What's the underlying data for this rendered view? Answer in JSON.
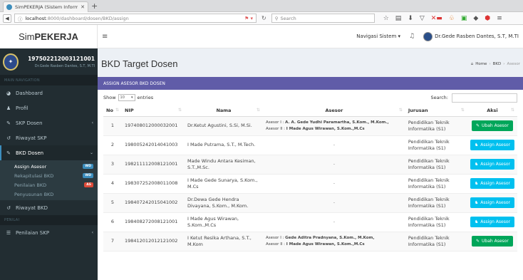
{
  "browser": {
    "tab_title": "SimPEKERJA (Sistem Inform...",
    "url_host": "localhost",
    "url_path": ":8000/dashboard/dosen/BKD/assign",
    "search_placeholder": "Search"
  },
  "header": {
    "logo_prefix": "Sim",
    "logo_bold": "PEKERJA",
    "nav_system": "Navigasi Sistem",
    "user_name": "Dr.Gede Rasben Dantes, S.T, M.TI"
  },
  "sidebar": {
    "profile_nip": "197502212003121001",
    "profile_name": "Dr.Gede Rasben Dantes, S.T, M.TI",
    "section_main": "MAIN NAVIGATION",
    "items": [
      {
        "label": "Dashboard",
        "icon": "dashboard-icon"
      },
      {
        "label": "Profil",
        "icon": "user-icon"
      },
      {
        "label": "SKP Dosen",
        "icon": "edit-icon"
      },
      {
        "label": "Riwayat SKP",
        "icon": "history-icon"
      },
      {
        "label": "BKD Dosen",
        "icon": "edit-icon"
      }
    ],
    "bkd_sub": [
      {
        "label": "Assign Asesor",
        "badge": "WD"
      },
      {
        "label": "Rekapitulasi BKD",
        "badge": "WD"
      },
      {
        "label": "Penilaian BKD",
        "badge": "AS"
      },
      {
        "label": "Penyusunan BKD",
        "badge": ""
      }
    ],
    "riwayat_bkd": "Riwayat BKD",
    "section_penilai": "PENILAI",
    "penilaian_skp": "Penilaian SKP"
  },
  "page": {
    "title": "BKD Target Dosen",
    "breadcrumb": [
      "Home",
      "BKD",
      "Asesor"
    ]
  },
  "box": {
    "title": "ASSIGN ASESOR BKD DOSEN",
    "show_label": "Show",
    "entries_value": "10",
    "entries_label": "entries",
    "search_label": "Search:"
  },
  "table": {
    "headers": [
      "No",
      "NIP",
      "Nama",
      "Asesor",
      "Jurusan",
      "Aksi"
    ],
    "rows": [
      {
        "no": "1",
        "nip": "197408012000032001",
        "nama": "Dr.Ketut Agustini, S.Si, M.Si.",
        "asesor1_label": "Asesor I :",
        "asesor1": "A. A. Gede Yudhi Paramartha, S.Kom., M.Kom.,",
        "asesor2_label": "Asesor II :",
        "asesor2": "I Made Agus Wirawan, S.Kom.,M.Cs",
        "jurusan": "Pendidikan Teknik Informatika (S1)",
        "aksi": "Ubah Asesor",
        "type": "ubah"
      },
      {
        "no": "2",
        "nip": "198005242014041003",
        "nama": "I Made Putrama, S.T., M.Tech.",
        "asesor_dash": "-",
        "jurusan": "Pendidikan Teknik Informatika (S1)",
        "aksi": "Assign Asesor",
        "type": "assign"
      },
      {
        "no": "3",
        "nip": "198211112008121001",
        "nama": "Made Windu Antara Kesiman, S.T.,M.Sc.",
        "asesor_dash": "-",
        "jurusan": "Pendidikan Teknik Informatika (S1)",
        "aksi": "Assign Asesor",
        "type": "assign"
      },
      {
        "no": "4",
        "nip": "198307252008011008",
        "nama": "I Made Gede Sunarya, S.Kom., M.Cs",
        "asesor_dash": "-",
        "jurusan": "Pendidikan Teknik Informatika (S1)",
        "aksi": "Assign Asesor",
        "type": "assign"
      },
      {
        "no": "5",
        "nip": "198407242015041002",
        "nama": "Dr.Dewa Gede Hendra Divayana, S.Kom., M.Kom.",
        "asesor_dash": "-",
        "jurusan": "Pendidikan Teknik Informatika (S1)",
        "aksi": "Assign Asesor",
        "type": "assign"
      },
      {
        "no": "6",
        "nip": "198408272008121001",
        "nama": "I Made Agus Wirawan, S.Kom.,M.Cs",
        "asesor_dash": "-",
        "jurusan": "Pendidikan Teknik Informatika (S1)",
        "aksi": "Assign Asesor",
        "type": "assign"
      },
      {
        "no": "7",
        "nip": "198412012012121002",
        "nama": "I Ketut Resika Arthana, S.T., M.Kom",
        "asesor1_label": "Asesor I :",
        "asesor1": "Gede Aditra Pradnyana, S.Kom., M.Kom,",
        "asesor2_label": "Asesor II :",
        "asesor2": "I Made Agus Wirawan, S.Kom.,M.Cs",
        "jurusan": "Pendidikan Teknik Informatika (S1)",
        "aksi": "Ubah Asesor",
        "type": "ubah"
      }
    ]
  },
  "colors": {
    "sidebar_bg": "#222d32",
    "box_header": "#605ca8",
    "btn_green": "#00a65a",
    "btn_blue": "#00c0ef"
  }
}
